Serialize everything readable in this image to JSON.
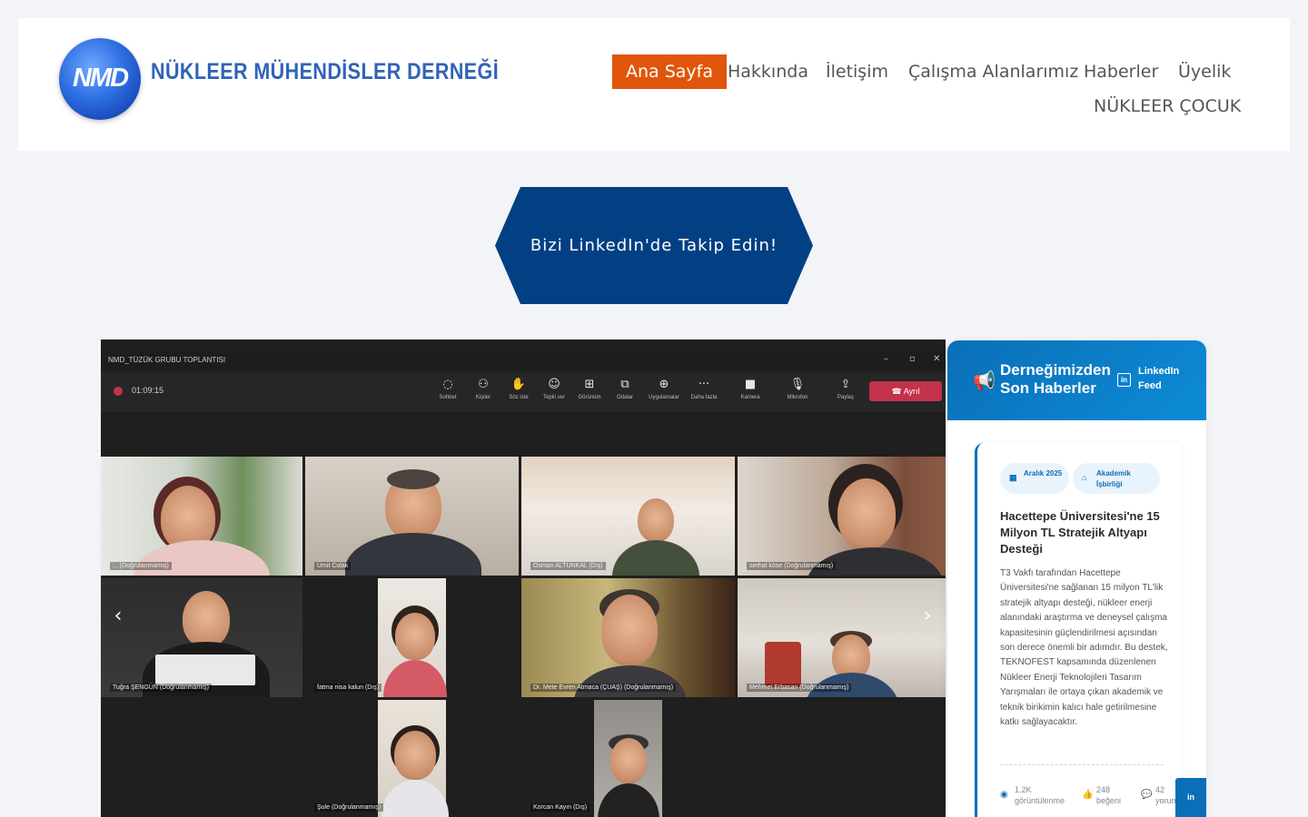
{
  "header": {
    "logo_mark": "NMD",
    "logo_name": "NÜKLEER MÜHENDİSLER DERNEĞİ",
    "nav": [
      {
        "label": "Ana Sayfa",
        "active": true
      },
      {
        "label": "Hakkında"
      },
      {
        "label": "İletişim"
      },
      {
        "label": "Çalışma Alanlarımız"
      },
      {
        "label": "Haberler"
      },
      {
        "label": "Üyelik"
      },
      {
        "label": "NÜKLEER ÇOCUK"
      }
    ]
  },
  "banner": {
    "label": "Bizi LinkedIn'de Takip Edin!"
  },
  "slider": {
    "prev_icon": "‹",
    "next_icon": "›",
    "meeting": {
      "title": "NMD_TÜZÜK GRUBU TOPLANTISI",
      "timer": "01:09:15",
      "leave_label": "Ayrıl",
      "toolbar": [
        {
          "label": "Sohbet",
          "icon": "chat-icon"
        },
        {
          "label": "Kişiler",
          "icon": "people-icon"
        },
        {
          "label": "Söz iste",
          "icon": "raise-hand-icon"
        },
        {
          "label": "Tepki ver",
          "icon": "react-icon"
        },
        {
          "label": "Görünüm",
          "icon": "view-icon"
        },
        {
          "label": "Odalar",
          "icon": "rooms-icon"
        },
        {
          "label": "Uygulamalar",
          "icon": "apps-icon"
        },
        {
          "label": "Daha fazla",
          "icon": "more-icon"
        },
        {
          "label": "Kamera",
          "icon": "camera-icon"
        },
        {
          "label": "Mikrofon",
          "icon": "mic-icon"
        },
        {
          "label": "Paylaş",
          "icon": "share-icon"
        }
      ],
      "participants": [
        "... (Doğrulanmamış)",
        "Umit Colak",
        "Osman ALTUNKAL (Dış)",
        "serhat köse (Doğrulanmamış)",
        "Tuğra ŞENGÜN (Doğrulanmamış)",
        "fatma nisa kalun (Dış)",
        "Dr. Mete Evren Atmaca (ÇUAŞ) (Doğrulanmamış)",
        "Mehmet Erbasan (Doğrulanmamış)",
        "Şule (Doğrulanmamış)",
        "Korcan Kayın (Dış)"
      ]
    }
  },
  "news": {
    "title": "Derneğimizden Son Haberler",
    "feed_label": "LinkedIn Feed",
    "colors": {
      "accent": "#0a6fb8",
      "nav_active": "#e0560a",
      "banner": "#034083"
    },
    "item": {
      "date_tag": "Aralık 2025",
      "category_tag": "Akademik İşbirliği",
      "title": "Hacettepe Üniversitesi'ne 15 Milyon TL Stratejik Altyapı Desteği",
      "body": "T3 Vakfı tarafından Hacettepe Üniversitesi'ne sağlanan 15 milyon TL'lik stratejik altyapı desteği, nükleer enerji alanındaki araştırma ve deneysel çalışma kapasitesinin güçlendirilmesi açısından son derece önemli bir adımdır. Bu destek, TEKNOFEST kapsamında düzenlenen Nükleer Enerji Teknolojileri Tasarım Yarışmaları ile ortaya çıkan akademik ve teknik birikimin kalıcı hale getirilmesine katkı sağlayacaktır.",
      "views": "1.2K görüntülenme",
      "likes": "248 beğeni",
      "comments": "42 yorum"
    }
  }
}
